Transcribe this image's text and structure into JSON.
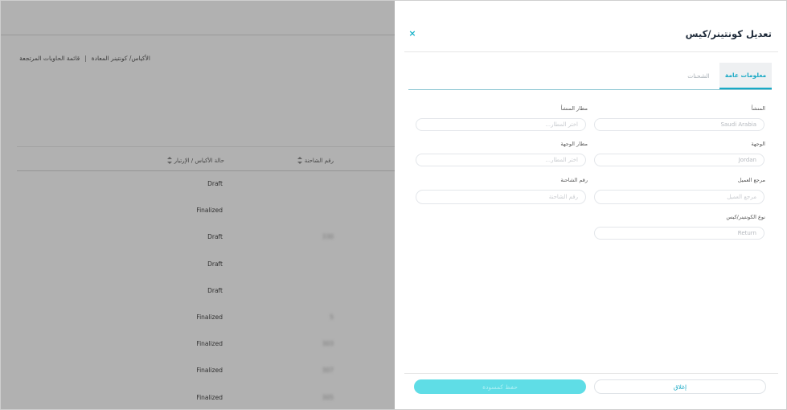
{
  "background": {
    "breadcrumb": {
      "current": "الأكياس/ كونتينر المعادة",
      "separator": "|",
      "list": "قائمة الحاويات المرتجعة"
    },
    "table": {
      "headers": {
        "status": "حالة الأكياس / الإرتيار",
        "truck_number": "رقم الشاحنة"
      },
      "rows": [
        {
          "status": "Draft",
          "truck": ""
        },
        {
          "status": "Finalized",
          "truck": ""
        },
        {
          "status": "Draft",
          "truck": "330"
        },
        {
          "status": "Draft",
          "truck": ""
        },
        {
          "status": "Draft",
          "truck": ""
        },
        {
          "status": "Finalized",
          "truck": "5"
        },
        {
          "status": "Finalized",
          "truck": "303"
        },
        {
          "status": "Finalized",
          "truck": "307"
        },
        {
          "status": "Finalized",
          "truck": "305"
        }
      ]
    }
  },
  "drawer": {
    "title": "تعديل كونتينر/كيس",
    "close_icon": "×",
    "tabs": {
      "general": "معلومات عامة",
      "shipments": "الشحنات"
    },
    "fields": {
      "origin": {
        "label": "المنشأ",
        "value": "Saudi Arabia"
      },
      "origin_airport": {
        "label": "مطار المنشأ",
        "placeholder": "اختر المطار..."
      },
      "destination": {
        "label": "الوجهة",
        "value": "Jordan"
      },
      "destination_airport": {
        "label": "مطار الوجهة",
        "placeholder": "اختر المطار..."
      },
      "customer_reference": {
        "label": "مرجع العميل",
        "placeholder": "مرجع العميل"
      },
      "truck_number": {
        "label": "رقم الشاحنة",
        "placeholder": "رقم الشاحنة"
      },
      "container_type": {
        "label": "نوع الكونتينر/كيس",
        "value": "Return"
      }
    },
    "buttons": {
      "close": "إغلاق",
      "save_draft": "حفظ كمسودة"
    }
  },
  "colors": {
    "accent": "#19a9c5",
    "save_button": "#5fdde6",
    "overlay": "rgba(70,70,70,0.42)"
  }
}
